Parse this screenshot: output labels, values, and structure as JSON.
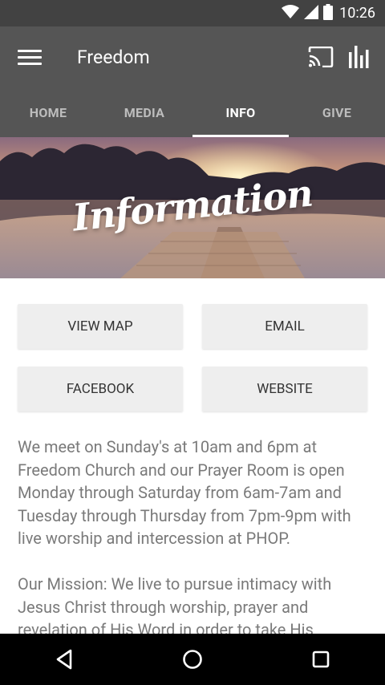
{
  "status_bar": {
    "time": "10:26",
    "icons": [
      "wifi-icon",
      "signal-icon",
      "battery-icon"
    ]
  },
  "app_bar": {
    "title": "Freedom",
    "actions": [
      "cast-icon",
      "stats-icon"
    ]
  },
  "tabs": [
    {
      "label": "HOME",
      "active": false
    },
    {
      "label": "MEDIA",
      "active": false
    },
    {
      "label": "INFO",
      "active": true
    },
    {
      "label": "GIVE",
      "active": false
    }
  ],
  "hero": {
    "title": "Information"
  },
  "buttons": {
    "view_map": "VIEW MAP",
    "email": "EMAIL",
    "facebook": "FACEBOOK",
    "website": "WEBSITE"
  },
  "content": {
    "paragraph1": "We meet on Sunday's at 10am and 6pm at Freedom Church and our Prayer Room is open Monday through Saturday from 6am-7am and Tuesday through Thursday from 7pm-9pm with live worship and intercession at PHOP.",
    "paragraph2": "Our Mission: We live to pursue intimacy with Jesus Christ through worship, prayer and revelation of His Word in order to take His"
  },
  "nav_bar": {
    "buttons": [
      "back-icon",
      "home-icon",
      "recents-icon"
    ]
  },
  "colors": {
    "app_bar": "#555555",
    "status_bar": "#424242",
    "button_bg": "#eeeeee",
    "text": "#7a7a7a"
  }
}
